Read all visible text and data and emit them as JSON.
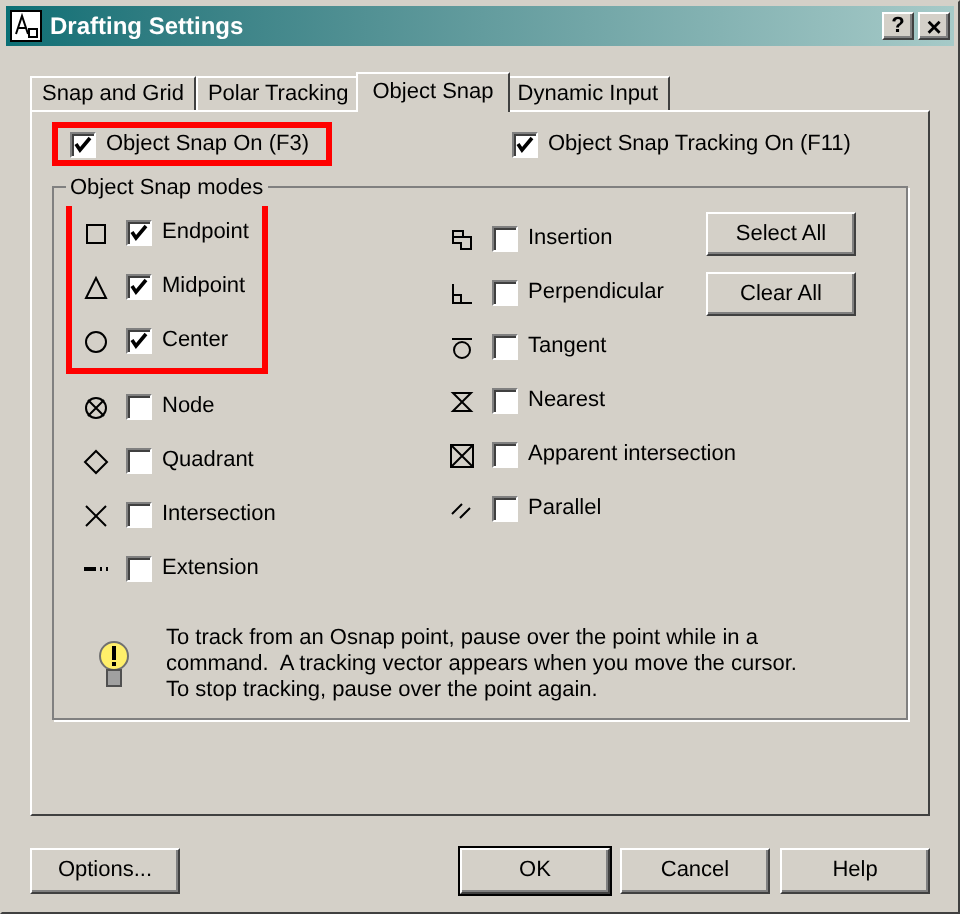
{
  "window": {
    "title": "Drafting Settings",
    "help_button": "?",
    "close_button": "×"
  },
  "tabs": [
    {
      "label": "Snap and Grid",
      "selected": false
    },
    {
      "label": "Polar Tracking",
      "selected": false
    },
    {
      "label": "Object Snap",
      "selected": true
    },
    {
      "label": "Dynamic Input",
      "selected": false
    }
  ],
  "snap_on": {
    "label": "Object Snap On (F3)",
    "checked": true,
    "highlighted": true
  },
  "tracking_on": {
    "label": "Object Snap Tracking On (F11)",
    "checked": true
  },
  "modes_group": {
    "title": "Object Snap modes",
    "left_groups": [
      {
        "highlighted": true,
        "modes": [
          {
            "kind": "endpoint",
            "label": "Endpoint",
            "checked": true
          },
          {
            "kind": "midpoint",
            "label": "Midpoint",
            "checked": true
          },
          {
            "kind": "center",
            "label": "Center",
            "checked": true
          }
        ]
      },
      {
        "highlighted": false,
        "modes": [
          {
            "kind": "node",
            "label": "Node",
            "checked": false
          },
          {
            "kind": "quadrant",
            "label": "Quadrant",
            "checked": false
          },
          {
            "kind": "intersection",
            "label": "Intersection",
            "checked": false
          },
          {
            "kind": "extension",
            "label": "Extension",
            "checked": false
          }
        ]
      }
    ],
    "right_modes": [
      {
        "kind": "insertion",
        "label": "Insertion",
        "checked": false
      },
      {
        "kind": "perpendicular",
        "label": "Perpendicular",
        "checked": false
      },
      {
        "kind": "tangent",
        "label": "Tangent",
        "checked": false
      },
      {
        "kind": "nearest",
        "label": "Nearest",
        "checked": false
      },
      {
        "kind": "apparent",
        "label": "Apparent intersection",
        "checked": false
      },
      {
        "kind": "parallel",
        "label": "Parallel",
        "checked": false
      }
    ],
    "buttons": [
      "Select All",
      "Clear All"
    ],
    "hint": "To track from an Osnap point, pause over the point while in a command.  A tracking vector appears when you move the cursor. To stop tracking, pause over the point again."
  },
  "footer": {
    "options_button": "Options...",
    "buttons": [
      {
        "label": "OK",
        "default": true
      },
      {
        "label": "Cancel",
        "default": false
      },
      {
        "label": "Help",
        "default": false
      }
    ]
  }
}
